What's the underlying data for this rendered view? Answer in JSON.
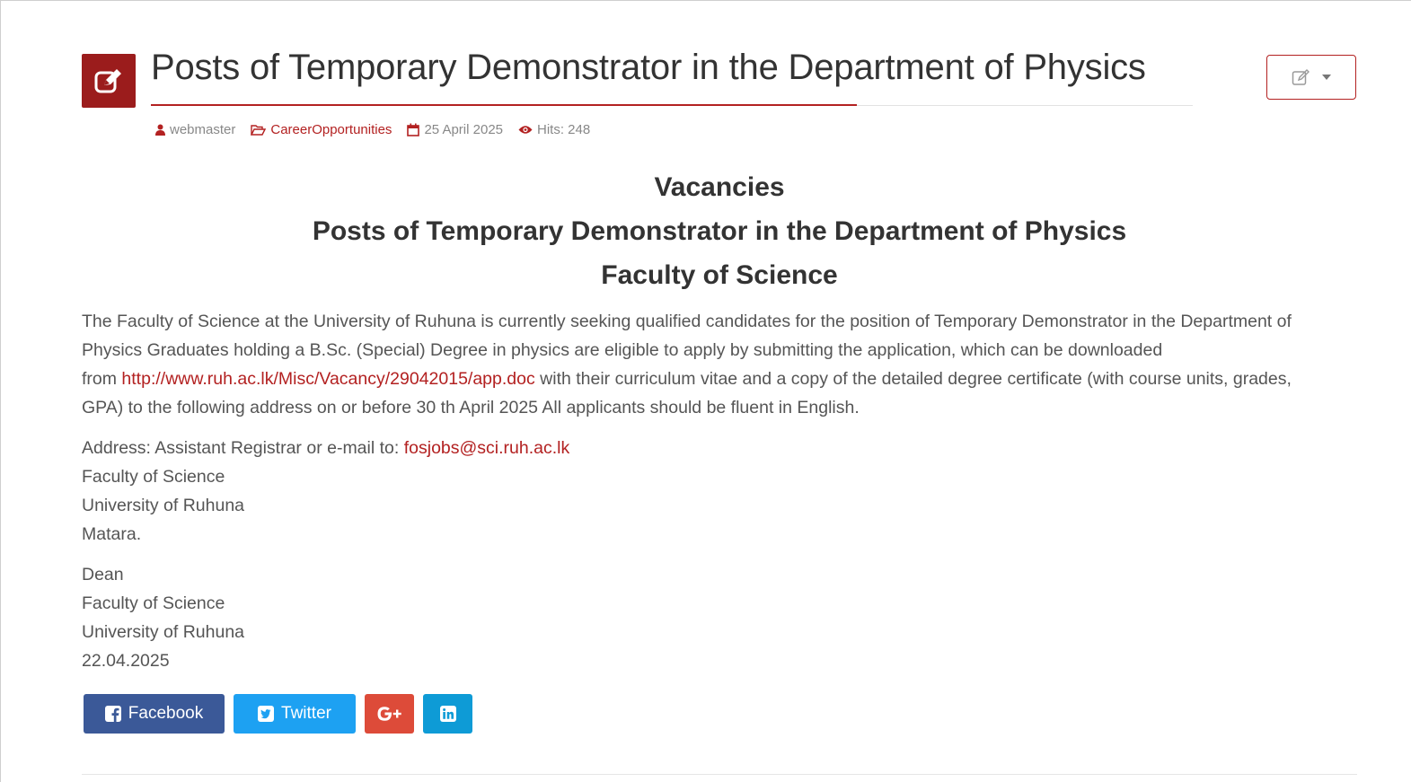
{
  "article": {
    "title": "Posts of Temporary Demonstrator in the Department of Physics",
    "meta": {
      "author": "webmaster",
      "category": "CareerOpportunities",
      "date": "25 April 2025",
      "hits": "Hits: 248"
    },
    "headings": [
      "Vacancies",
      "Posts of Temporary Demonstrator in the Department of Physics",
      "Faculty of Science"
    ],
    "body": {
      "intro_line1": "The Faculty of Science at the University of Ruhuna is currently seeking qualified candidates for the position of Temporary Demonstrator in the Department of",
      "intro_line2": "Physics Graduates holding a B.Sc. (Special) Degree in physics are eligible to apply by submitting the application, which can be downloaded",
      "intro_from": "from ",
      "app_link": "http://www.ruh.ac.lk/Misc/Vacancy/29042015/app.doc",
      "intro_line3_rest": " with their curriculum vitae and a copy of the detailed degree certificate (with course units, grades,",
      "intro_line4": "GPA) to the following address on or before 30 th April 2025 All applicants should be fluent in English.",
      "address_prefix": "Address: Assistant Registrar or e-mail to: ",
      "email": "fosjobs@sci.ruh.ac.lk",
      "address_lines": [
        "Faculty of Science",
        "University of Ruhuna",
        "Matara."
      ],
      "signature_lines": [
        "Dean",
        "Faculty of Science",
        "University of Ruhuna",
        "22.04.2025"
      ]
    }
  },
  "share": {
    "facebook": "Facebook",
    "twitter": "Twitter"
  },
  "colors": {
    "accent": "#b32121",
    "icon_box": "#9b1c1c",
    "facebook": "#3b5998",
    "twitter": "#1da1f2",
    "google_plus": "#dd4b39",
    "linkedin": "#0e9bd6"
  }
}
